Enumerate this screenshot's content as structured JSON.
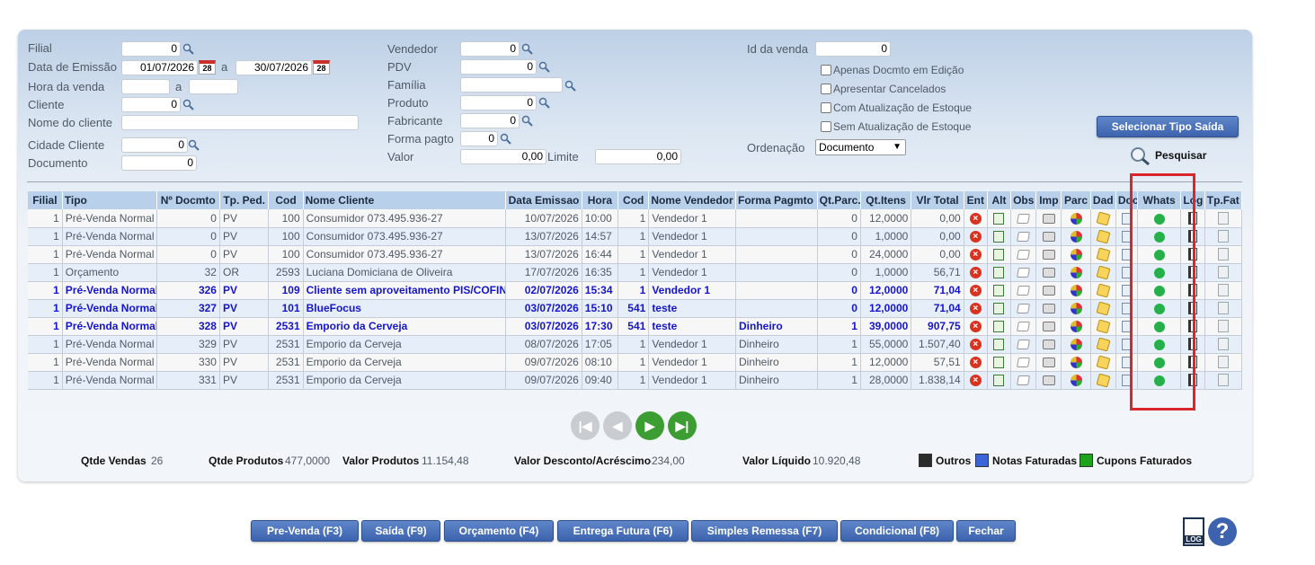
{
  "filters": {
    "filial_label": "Filial",
    "filial_value": "0",
    "data_emissao_label": "Data de Emissão",
    "data_ini": "01/07/2026",
    "data_sep": "a",
    "data_fim": "30/07/2026",
    "cal_day": "28",
    "hora_label": "Hora da venda",
    "hora_sep": "a",
    "cliente_label": "Cliente",
    "cliente_value": "0",
    "nome_cliente_label": "Nome do cliente",
    "cidade_label": "Cidade Cliente",
    "cidade_value": "0",
    "documento_label": "Documento",
    "documento_value": "0",
    "vendedor_label": "Vendedor",
    "vendedor_value": "0",
    "pdv_label": "PDV",
    "pdv_value": "0",
    "familia_label": "Família",
    "produto_label": "Produto",
    "produto_value": "0",
    "fabricante_label": "Fabricante",
    "fabricante_value": "0",
    "forma_pagto_label": "Forma pagto",
    "forma_pagto_value": "0",
    "valor_label": "Valor",
    "valor_value": "0,00",
    "limite_label": "Limite",
    "limite_value": "0,00",
    "id_venda_label": "Id da venda",
    "id_venda_value": "0",
    "chk_edicao": "Apenas Docmto em Edição",
    "chk_cancelados": "Apresentar Cancelados",
    "chk_com_estoque": "Com Atualização de Estoque",
    "chk_sem_estoque": "Sem Atualização de Estoque",
    "ordenacao_label": "Ordenação",
    "ordenacao_value": "Documento",
    "selecionar_tipo_saida": "Selecionar Tipo Saída",
    "pesquisar": "Pesquisar"
  },
  "table": {
    "headers": [
      "Filial",
      "Tipo",
      "Nº Docmto",
      "Tp. Ped.",
      "Cod",
      "Nome Cliente",
      "Data Emissao",
      "Hora",
      "Cod",
      "Nome Vendedor",
      "Forma Pagmto",
      "Qt.Parc.",
      "Qt.Itens",
      "Vlr Total",
      "Ent",
      "Alt",
      "Obs",
      "Imp",
      "Parc",
      "Dad",
      "Doc",
      "Whats",
      "Log",
      "Tp.Fat"
    ],
    "rows": [
      {
        "filial": "1",
        "tipo": "Pré-Venda Normal",
        "docmto": "0",
        "tp": "PV",
        "cod": "100",
        "cliente": "Consumidor 073.495.936-27",
        "data": "10/07/2026",
        "hora": "10:00",
        "codv": "1",
        "vendedor": "Vendedor 1",
        "forma": "",
        "parc": "0",
        "itens": "12,0000",
        "total": "0,00",
        "bold": false
      },
      {
        "filial": "1",
        "tipo": "Pré-Venda Normal",
        "docmto": "0",
        "tp": "PV",
        "cod": "100",
        "cliente": "Consumidor 073.495.936-27",
        "data": "13/07/2026",
        "hora": "14:57",
        "codv": "1",
        "vendedor": "Vendedor 1",
        "forma": "",
        "parc": "0",
        "itens": "1,0000",
        "total": "0,00",
        "bold": false
      },
      {
        "filial": "1",
        "tipo": "Pré-Venda Normal",
        "docmto": "0",
        "tp": "PV",
        "cod": "100",
        "cliente": "Consumidor 073.495.936-27",
        "data": "13/07/2026",
        "hora": "16:44",
        "codv": "1",
        "vendedor": "Vendedor 1",
        "forma": "",
        "parc": "0",
        "itens": "24,0000",
        "total": "0,00",
        "bold": false
      },
      {
        "filial": "1",
        "tipo": "Orçamento",
        "docmto": "32",
        "tp": "OR",
        "cod": "2593",
        "cliente": "Luciana Domiciana de Oliveira",
        "data": "17/07/2026",
        "hora": "16:35",
        "codv": "1",
        "vendedor": "Vendedor 1",
        "forma": "",
        "parc": "0",
        "itens": "1,0000",
        "total": "56,71",
        "bold": false
      },
      {
        "filial": "1",
        "tipo": "Pré-Venda Normal",
        "docmto": "326",
        "tp": "PV",
        "cod": "109",
        "cliente": "Cliente sem aproveitamento PIS/COFINS",
        "data": "02/07/2026",
        "hora": "15:34",
        "codv": "1",
        "vendedor": "Vendedor 1",
        "forma": "",
        "parc": "0",
        "itens": "12,0000",
        "total": "71,04",
        "bold": true
      },
      {
        "filial": "1",
        "tipo": "Pré-Venda Normal",
        "docmto": "327",
        "tp": "PV",
        "cod": "101",
        "cliente": "BlueFocus",
        "data": "03/07/2026",
        "hora": "15:10",
        "codv": "541",
        "vendedor": "teste",
        "forma": "",
        "parc": "0",
        "itens": "12,0000",
        "total": "71,04",
        "bold": true
      },
      {
        "filial": "1",
        "tipo": "Pré-Venda Normal",
        "docmto": "328",
        "tp": "PV",
        "cod": "2531",
        "cliente": "Emporio da Cerveja",
        "data": "03/07/2026",
        "hora": "17:30",
        "codv": "541",
        "vendedor": "teste",
        "forma": "Dinheiro",
        "parc": "1",
        "itens": "39,0000",
        "total": "907,75",
        "bold": true
      },
      {
        "filial": "1",
        "tipo": "Pré-Venda Normal",
        "docmto": "329",
        "tp": "PV",
        "cod": "2531",
        "cliente": "Emporio da Cerveja",
        "data": "08/07/2026",
        "hora": "17:05",
        "codv": "1",
        "vendedor": "Vendedor 1",
        "forma": "Dinheiro",
        "parc": "1",
        "itens": "55,0000",
        "total": "1.507,40",
        "bold": false
      },
      {
        "filial": "1",
        "tipo": "Pré-Venda Normal",
        "docmto": "330",
        "tp": "PV",
        "cod": "2531",
        "cliente": "Emporio da Cerveja",
        "data": "09/07/2026",
        "hora": "08:10",
        "codv": "1",
        "vendedor": "Vendedor 1",
        "forma": "Dinheiro",
        "parc": "1",
        "itens": "12,0000",
        "total": "57,51",
        "bold": false
      },
      {
        "filial": "1",
        "tipo": "Pré-Venda Normal",
        "docmto": "331",
        "tp": "PV",
        "cod": "2531",
        "cliente": "Emporio da Cerveja",
        "data": "09/07/2026",
        "hora": "09:40",
        "codv": "1",
        "vendedor": "Vendedor 1",
        "forma": "Dinheiro",
        "parc": "1",
        "itens": "28,0000",
        "total": "1.838,14",
        "bold": false
      }
    ]
  },
  "summary": {
    "qtde_vendas_label": "Qtde Vendas",
    "qtde_vendas": "26",
    "qtde_produtos_label": "Qtde Produtos",
    "qtde_produtos": "477,0000",
    "valor_produtos_label": "Valor Produtos",
    "valor_produtos": "11.154,48",
    "valor_desconto_label": "Valor Desconto/Acréscimo",
    "valor_desconto": "-234,00",
    "valor_liquido_label": "Valor Líquido",
    "valor_liquido": "10.920,48"
  },
  "legend": [
    {
      "label": "Outros",
      "color": "#2b2b2b"
    },
    {
      "label": "Notas Faturadas",
      "color": "#3a64d8"
    },
    {
      "label": "Cupons Faturados",
      "color": "#1fa31f"
    }
  ],
  "buttons": {
    "pre_venda": "Pre-Venda (F3)",
    "saida": "Saída (F9)",
    "orcamento": "Orçamento (F4)",
    "entrega_futura": "Entrega Futura (F6)",
    "simples_remessa": "Simples Remessa (F7)",
    "condicional": "Condicional (F8)",
    "fechar": "Fechar",
    "log": "LOG",
    "help": "?"
  },
  "colors": {
    "highlight_box": "#d9262a",
    "button_blue": "#3d63ae",
    "bold_row_text": "#1515cc"
  }
}
